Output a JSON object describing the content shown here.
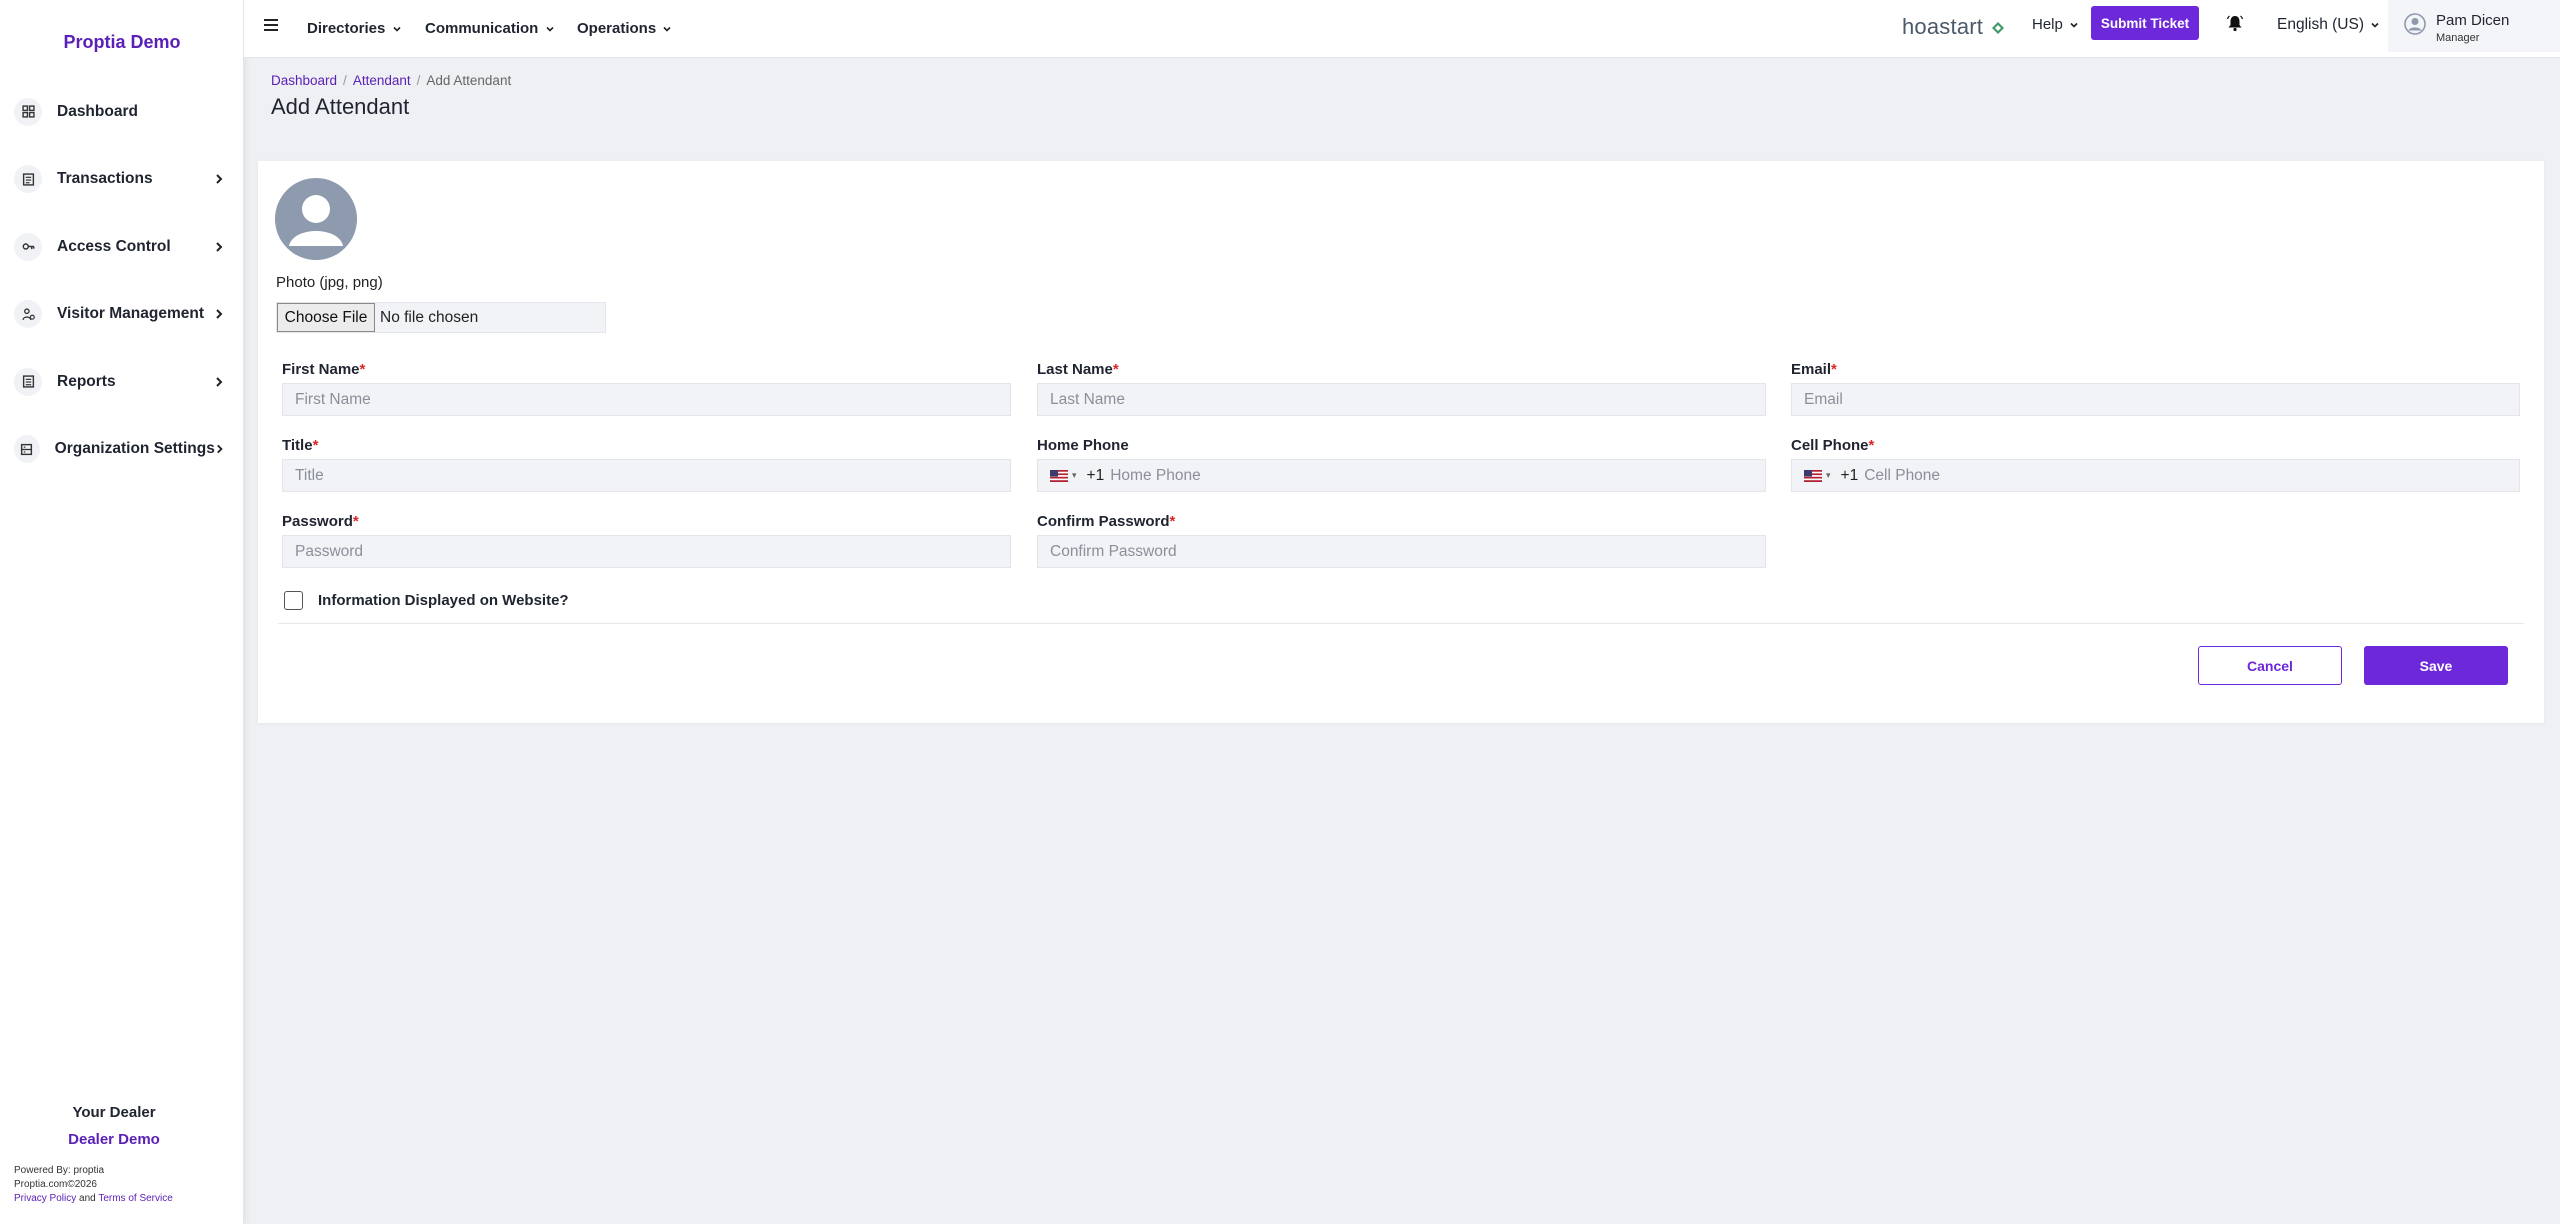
{
  "sidebar": {
    "brand": "Proptia Demo",
    "items": [
      {
        "label": "Dashboard",
        "icon": "dashboard-icon"
      },
      {
        "label": "Transactions",
        "icon": "transactions-icon"
      },
      {
        "label": "Access Control",
        "icon": "key-icon"
      },
      {
        "label": "Visitor Management",
        "icon": "visitor-icon"
      },
      {
        "label": "Reports",
        "icon": "reports-icon"
      },
      {
        "label": "Organization Settings",
        "icon": "settings-icon"
      }
    ],
    "footer": {
      "dealer_title": "Your Dealer",
      "dealer_name": "Dealer Demo",
      "powered_by": "Powered By: proptia",
      "copyright": "Proptia.com©2026",
      "privacy": "Privacy Policy",
      "and": "and",
      "terms": "Terms of Service"
    }
  },
  "topbar": {
    "menus": [
      "Directories",
      "Communication",
      "Operations"
    ],
    "logo_text": "hoastart",
    "help": "Help",
    "submit_ticket": "Submit Ticket",
    "language": "English (US)",
    "user_name": "Pam Dicen",
    "user_role": "Manager"
  },
  "breadcrumb": {
    "items": [
      "Dashboard",
      "Attendant",
      "Add Attendant"
    ],
    "sep": "/"
  },
  "page_title": "Add Attendant",
  "form": {
    "photo_label": "Photo (jpg, png)",
    "choose_file": "Choose File",
    "no_file": "No file chosen",
    "required_mark": "*",
    "fields": {
      "first_name": {
        "label": "First Name",
        "placeholder": "First Name",
        "value": ""
      },
      "last_name": {
        "label": "Last Name",
        "placeholder": "Last Name",
        "value": ""
      },
      "email": {
        "label": "Email",
        "placeholder": "Email",
        "value": ""
      },
      "title": {
        "label": "Title",
        "placeholder": "Title",
        "value": ""
      },
      "home_phone": {
        "label": "Home Phone",
        "placeholder": "Home Phone",
        "dial_code": "+1",
        "value": ""
      },
      "cell_phone": {
        "label": "Cell Phone",
        "placeholder": "Cell Phone",
        "dial_code": "+1",
        "value": ""
      },
      "password": {
        "label": "Password",
        "placeholder": "Password",
        "value": ""
      },
      "confirm_password": {
        "label": "Confirm Password",
        "placeholder": "Confirm Password",
        "value": ""
      }
    },
    "display_checkbox_label": "Information Displayed on Website?",
    "display_checked": false,
    "cancel": "Cancel",
    "save": "Save"
  },
  "colors": {
    "accent": "#6d28d9",
    "brand_text": "#5b21b6",
    "required": "#dc2626",
    "background": "#eef0f4"
  }
}
